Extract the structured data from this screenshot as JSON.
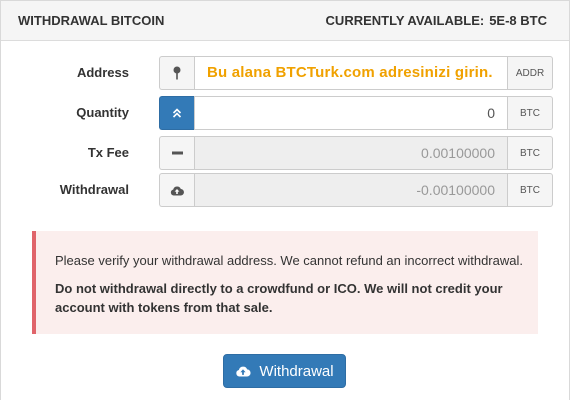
{
  "header": {
    "title": "WITHDRAWAL BITCOIN",
    "available_label": "CURRENTLY AVAILABLE:",
    "available_value": "5E-8 BTC"
  },
  "form": {
    "address": {
      "label": "Address",
      "value": "Bu alana BTCTurk.com adresinizi girin.",
      "suffix": "ADDR",
      "icon": "map-pin-icon"
    },
    "quantity": {
      "label": "Quantity",
      "value": "0",
      "suffix": "BTC",
      "icon": "chevron-double-up-icon"
    },
    "fee": {
      "label": "Tx Fee",
      "value": "0.00100000",
      "suffix": "BTC",
      "icon": "minus-icon"
    },
    "withdrawal": {
      "label": "Withdrawal",
      "value": "-0.00100000",
      "suffix": "BTC",
      "icon": "cloud-upload-icon"
    }
  },
  "alert": {
    "line1": "Please verify your withdrawal address. We cannot refund an incorrect withdrawal.",
    "line2": "Do not withdrawal directly to a crowdfund or ICO. We will not credit your account with tokens from that sale."
  },
  "submit": {
    "label": "Withdrawal",
    "icon": "cloud-upload-icon"
  },
  "colors": {
    "primary": "#337ab7",
    "address_text": "#f0a100",
    "alert_border": "#e0646a",
    "alert_bg": "#fbeeed"
  }
}
